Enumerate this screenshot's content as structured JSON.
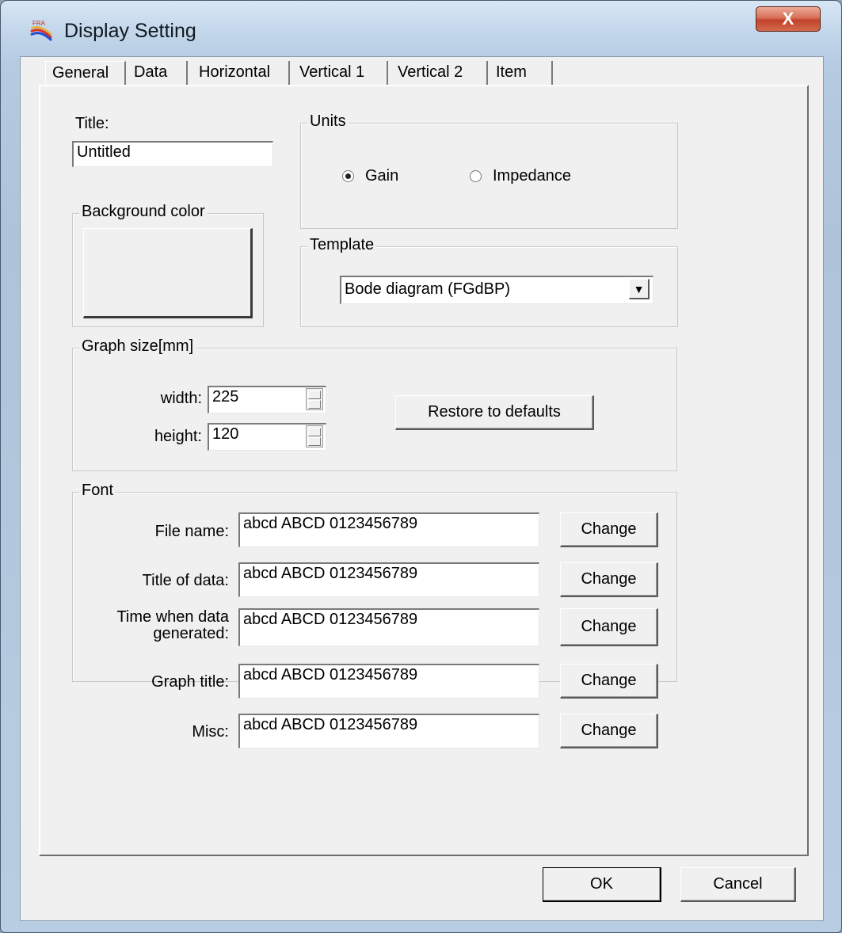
{
  "window": {
    "title": "Display Setting",
    "close_glyph": "X",
    "icon": "fra-app-icon"
  },
  "tabs": [
    {
      "label": "General",
      "active": true
    },
    {
      "label": "Data",
      "active": false
    },
    {
      "label": "Horizontal",
      "active": false
    },
    {
      "label": "Vertical 1",
      "active": false
    },
    {
      "label": "Vertical 2",
      "active": false
    },
    {
      "label": "Item",
      "active": false
    }
  ],
  "title_field": {
    "label": "Title:",
    "value": "Untitled"
  },
  "background": {
    "legend": "Background color",
    "color": "#f0f0f0"
  },
  "units": {
    "legend": "Units",
    "options": [
      {
        "label": "Gain",
        "selected": true
      },
      {
        "label": "Impedance",
        "selected": false
      }
    ]
  },
  "template": {
    "legend": "Template",
    "selected": "Bode diagram (FGdBP)",
    "arrow_glyph": "▼"
  },
  "graph_size": {
    "legend": "Graph size[mm]",
    "width_label": "width:",
    "width_value": "225",
    "height_label": "height:",
    "height_value": "120",
    "restore_label": "Restore to defaults"
  },
  "font": {
    "legend": "Font",
    "rows": [
      {
        "label": "File name:",
        "sample": "abcd ABCD 0123456789",
        "button": "Change"
      },
      {
        "label": "Title of data:",
        "sample": "abcd ABCD 0123456789",
        "button": "Change"
      },
      {
        "label_line1": "Time when data",
        "label_line2": "generated:",
        "sample": "abcd ABCD 0123456789",
        "button": "Change"
      },
      {
        "label": "Graph title:",
        "sample": "abcd ABCD 0123456789",
        "button": "Change"
      },
      {
        "label": "Misc:",
        "sample": "abcd ABCD 0123456789",
        "button": "Change"
      }
    ]
  },
  "buttons": {
    "ok": "OK",
    "cancel": "Cancel"
  }
}
